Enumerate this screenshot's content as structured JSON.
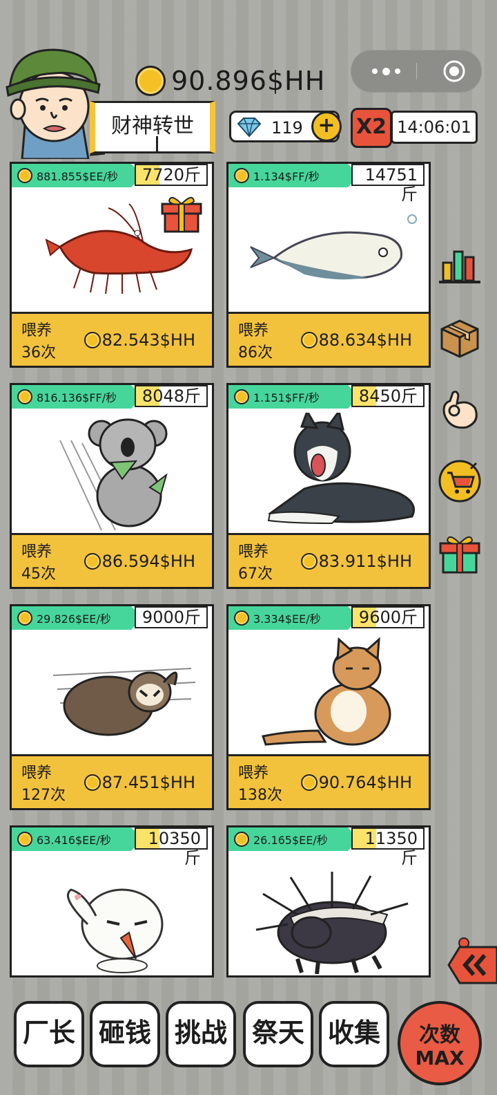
{
  "header": {
    "coin_total": "90.896$HH",
    "title": "财神转世",
    "gems": "119",
    "multiplier": "X2",
    "timer": "14:06:01"
  },
  "colors": {
    "rate_tag": "#46d69b",
    "feed_bar": "#f3c23d",
    "coin": "#f4c025",
    "max_button": "#e95b44",
    "background": "#a9a9a4"
  },
  "cards": [
    {
      "animal": "shrimp",
      "rate": "881.855$EE/秒",
      "weight": "7720斤",
      "feed_label": "喂养",
      "feed_count": "36次",
      "price": "82.543$HH",
      "has_gift": true
    },
    {
      "animal": "fish",
      "rate": "1.134$FF/秒",
      "weight": "14751斤",
      "feed_label": "喂养",
      "feed_count": "86次",
      "price": "88.634$HH"
    },
    {
      "animal": "koala",
      "rate": "816.136$FF/秒",
      "weight": "8048斤",
      "feed_label": "喂养",
      "feed_count": "45次",
      "price": "86.594$HH"
    },
    {
      "animal": "husky",
      "rate": "1.151$FF/秒",
      "weight": "8450斤",
      "feed_label": "喂养",
      "feed_count": "67次",
      "price": "83.911$HH"
    },
    {
      "animal": "sloth",
      "rate": "29.826$EE/秒",
      "weight": "9000斤",
      "feed_label": "喂养",
      "feed_count": "127次",
      "price": "87.451$HH"
    },
    {
      "animal": "cat",
      "rate": "3.334$EE/秒",
      "weight": "9600斤",
      "feed_label": "喂养",
      "feed_count": "138次",
      "price": "90.764$HH"
    },
    {
      "animal": "rabbit",
      "rate": "63.416$EE/秒",
      "weight": "10350斤"
    },
    {
      "animal": "honey-badger",
      "rate": "26.165$EE/秒",
      "weight": "11350斤"
    }
  ],
  "side_icons": [
    "chart-icon",
    "box-icon",
    "ok-hand-icon",
    "cart-icon",
    "gift-icon"
  ],
  "nav": {
    "factory": "厂长",
    "smash": "砸钱",
    "challenge": "挑战",
    "worship": "祭天",
    "collect": "收集",
    "max_line1": "次数",
    "max_line2": "MAX"
  }
}
